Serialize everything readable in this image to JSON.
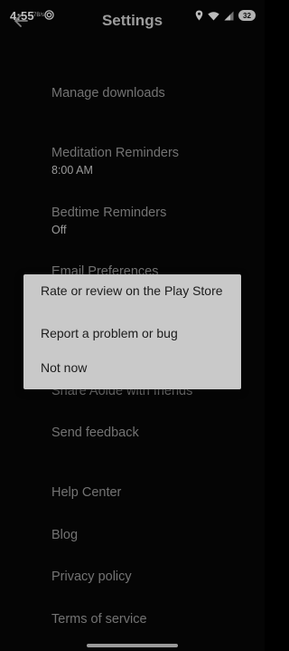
{
  "status_bar": {
    "time": "4:55",
    "net_speed": "7B/s",
    "battery": "32"
  },
  "header": {
    "title": "Settings"
  },
  "settings": {
    "items": [
      {
        "label": "Manage downloads",
        "value": ""
      },
      {
        "label": "Meditation Reminders",
        "value": "8:00 AM"
      },
      {
        "label": "Bedtime Reminders",
        "value": "Off"
      },
      {
        "label": "Email Preferences",
        "value": ""
      },
      {
        "label": "Share Aolde with friends",
        "value": ""
      },
      {
        "label": "Send feedback",
        "value": ""
      },
      {
        "label": "Help Center",
        "value": ""
      },
      {
        "label": "Blog",
        "value": ""
      },
      {
        "label": "Privacy policy",
        "value": ""
      },
      {
        "label": "Terms of service",
        "value": ""
      }
    ]
  },
  "dialog": {
    "options": [
      "Rate or review on the Play Store",
      "Report a problem or bug",
      "Not now"
    ]
  },
  "colors": {
    "background": "#070707",
    "dialog": "#c9c9c9",
    "label": "#8d8d8d"
  }
}
